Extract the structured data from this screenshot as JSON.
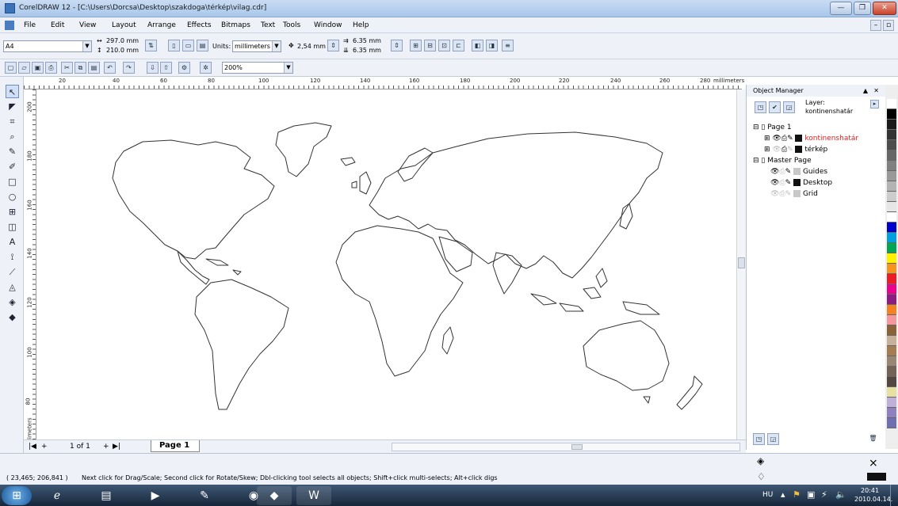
{
  "window": {
    "title": "CorelDRAW 12 - [C:\\Users\\Dorcsa\\Desktop\\szakdoga\\térkép\\vilag.cdr]"
  },
  "menu": [
    "File",
    "Edit",
    "View",
    "Layout",
    "Arrange",
    "Effects",
    "Bitmaps",
    "Text",
    "Tools",
    "Window",
    "Help"
  ],
  "property_bar": {
    "paper_size": "A4",
    "page_width": "297.0 mm",
    "page_height": "210.0 mm",
    "units_label": "Units:",
    "units_value": "millimeters",
    "nudge": "2,54 mm",
    "dup_x": "6.35 mm",
    "dup_y": "6.35 mm"
  },
  "standard_bar": {
    "zoom": "200%"
  },
  "ruler": {
    "horizontal_ticks": [
      "20",
      "40",
      "60",
      "80",
      "100",
      "120",
      "140",
      "160",
      "180",
      "200",
      "220",
      "240",
      "260",
      "280"
    ],
    "units": "millimeters",
    "vertical_ticks": [
      "200",
      "180",
      "160",
      "140",
      "120",
      "100",
      "80"
    ],
    "corner_units": "millimeters"
  },
  "page_nav": {
    "counter": "1 of 1",
    "tab": "Page 1"
  },
  "object_manager": {
    "title": "Object Manager",
    "layer_label": "Layer:",
    "layer_name": "kontinenshatár",
    "tree": [
      {
        "label": "Page 1",
        "type": "page"
      },
      {
        "label": "kontinenshatár",
        "type": "layer",
        "color": "#e02020",
        "swatch": "#111111"
      },
      {
        "label": "térkép",
        "type": "layer",
        "color": "#000000",
        "swatch": "#111111"
      },
      {
        "label": "Master Page",
        "type": "page"
      },
      {
        "label": "Guides",
        "type": "master-layer",
        "color": "#000000",
        "swatch": "#c8c8c8"
      },
      {
        "label": "Desktop",
        "type": "master-layer",
        "color": "#000000",
        "swatch": "#111111"
      },
      {
        "label": "Grid",
        "type": "master-layer",
        "color": "#000000",
        "swatch": "#c8c8c8"
      }
    ]
  },
  "palette": [
    "#ffffff",
    "#000000",
    "#1a1a1a",
    "#333333",
    "#4d4d4d",
    "#666666",
    "#808080",
    "#999999",
    "#b3b3b3",
    "#cccccc",
    "#e6e6e6",
    "#ffffff",
    "#0000cc",
    "#00a0e0",
    "#00a651",
    "#fff200",
    "#f7941d",
    "#ed1c24",
    "#ec008c",
    "#8b1d82",
    "#f58220",
    "#f5989d",
    "#8c6239",
    "#c7b299",
    "#a67c52",
    "#998675",
    "#736357",
    "#534741",
    "#e8e0a0",
    "#c0b0d8",
    "#9080c0",
    "#7070b0"
  ],
  "status": {
    "coords": "( 23,465; 206,841 )",
    "hint": "Next click for Drag/Scale; Second click for Rotate/Skew; Dbl-clicking tool selects all objects; Shift+click multi-selects; Alt+click digs"
  },
  "taskbar": {
    "lang": "HU",
    "time": "20:41",
    "date": "2010.04.14."
  },
  "colors": {
    "accent": "#3c73b8",
    "map_outline": "#333333"
  }
}
